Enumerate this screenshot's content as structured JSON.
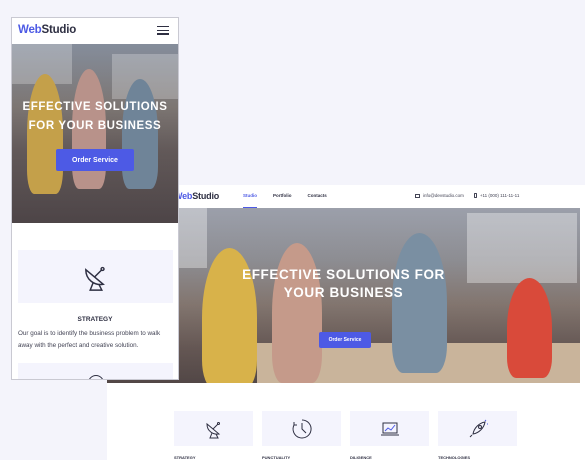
{
  "mobile": {
    "logo": {
      "accent": "Web",
      "rest": "Studio"
    },
    "menu_icon": "burger-menu-icon",
    "hero": {
      "title_line1": "Effective Solutions",
      "title_line2": "for your business",
      "button_label": "Order Service"
    },
    "feature": {
      "icon": "satellite-antenna-icon",
      "title": "Strategy",
      "text": "Our goal is to identify the business problem to walk away with the perfect and creative solution."
    },
    "next_feature_icon": "clock-icon"
  },
  "desktop": {
    "logo": {
      "accent": "Web",
      "rest": "Studio"
    },
    "nav": [
      "Studio",
      "Portfolio",
      "Contacts"
    ],
    "active_nav": "Studio",
    "contacts": {
      "email": "info@devstudio.com",
      "phone": "+11 (000) 111-11-11"
    },
    "hero": {
      "title_line1": "Effective Solutions for",
      "title_line2": "your business",
      "button_label": "Order Service"
    },
    "features": [
      {
        "title": "Strategy",
        "icon": "satellite-antenna-icon"
      },
      {
        "title": "Punctuality",
        "icon": "clock-icon"
      },
      {
        "title": "Diligence",
        "icon": "laptop-chart-icon"
      },
      {
        "title": "Technologies",
        "icon": "rocket-icon"
      }
    ]
  },
  "colors": {
    "accent": "#4d5ae5",
    "dark": "#2e2f42",
    "text": "#434455",
    "feature_bg": "#f4f4fd",
    "page_bg": "#f4f4fb"
  }
}
